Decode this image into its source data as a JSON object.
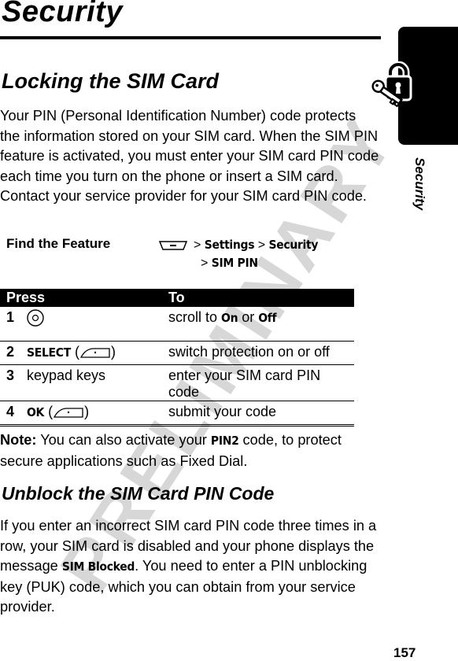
{
  "watermark": "PRELIMINARY",
  "page": {
    "title": "Security",
    "number": "157",
    "side_tab_label": "Security",
    "side_tab_icon": "lock-and-key-icon"
  },
  "section1": {
    "heading": "Locking the SIM Card",
    "intro": "Your PIN (Personal Identification Number) code protects the information stored on your SIM card. When the SIM PIN feature is activated, you must enter your SIM card PIN code each time you turn on the phone or insert a SIM card. Contact your service provider for your SIM card PIN code.",
    "find_feature": {
      "label": "Find the Feature",
      "key_icon": "menu-key-icon",
      "sep": ">",
      "path": [
        "Settings",
        "Security",
        "SIM PIN"
      ]
    },
    "table": {
      "headers": [
        "Press",
        "To"
      ],
      "rows": [
        {
          "num": "1",
          "press_icon": "nav-key-icon",
          "press": "",
          "to_pre": "scroll to ",
          "to_opt1": "On",
          "to_mid": " or ",
          "to_opt2": "Off"
        },
        {
          "num": "2",
          "press": "SELECT",
          "press_icon": "right-soft-key-icon",
          "to": "switch protection on or off"
        },
        {
          "num": "3",
          "press": "keypad keys",
          "to": "enter your SIM card PIN code"
        },
        {
          "num": "4",
          "press": "OK",
          "press_icon": "right-soft-key-icon",
          "to": "submit your code"
        }
      ]
    },
    "note": {
      "label": "Note:",
      "text_pre": " You can also activate your ",
      "code": "PIN2",
      "text_post": " code, to protect secure applications such as Fixed Dial."
    }
  },
  "section2": {
    "heading": "Unblock the SIM Card PIN Code",
    "text_pre": "If you enter an incorrect SIM card PIN code three times in a row, your SIM card is disabled and your phone displays the message ",
    "message": "SIM Blocked",
    "text_post": ". You need to enter a PIN unblocking key (PUK) code, which you can obtain from your service provider."
  }
}
